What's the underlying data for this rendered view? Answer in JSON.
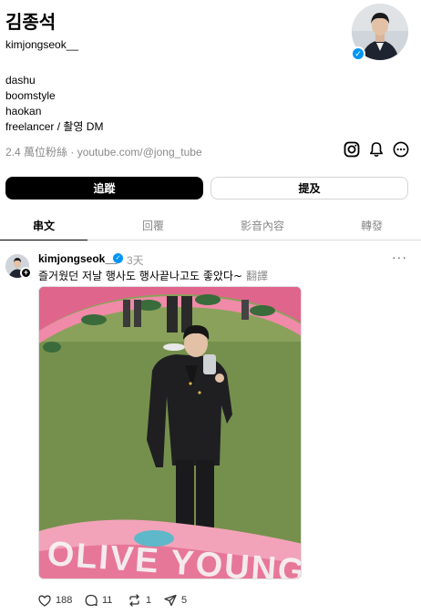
{
  "profile": {
    "name": "김종석",
    "handle": "kimjongseok__",
    "bio_lines": [
      "dashu",
      "boomstyle",
      "haokan",
      "freelancer / 촬영 DM"
    ],
    "followers": "2.4 萬位粉絲",
    "separator": " · ",
    "link": "youtube.com/@jong_tube"
  },
  "header_icons": [
    "instagram-icon",
    "bell-icon",
    "more-circle-icon"
  ],
  "actions": {
    "follow_label": "追蹤",
    "mention_label": "提及"
  },
  "tabs": [
    {
      "label": "串文",
      "active": true
    },
    {
      "label": "回覆",
      "active": false
    },
    {
      "label": "影音內容",
      "active": false
    },
    {
      "label": "轉發",
      "active": false
    }
  ],
  "post": {
    "username": "kimjongseok__",
    "time": "3天",
    "more": "···",
    "text": "즐거웠던 저날 행사도 행사끝나고도 좋았다~",
    "translate_label": "翻譯",
    "photo_sign_text": "OLIVE YOUNG",
    "likes": "188",
    "comments": "11",
    "reposts": "1",
    "shares": "5"
  },
  "colors": {
    "accent_verified": "#0095f6",
    "follow_button": "#000000",
    "muted_text": "#8a8a8a"
  }
}
